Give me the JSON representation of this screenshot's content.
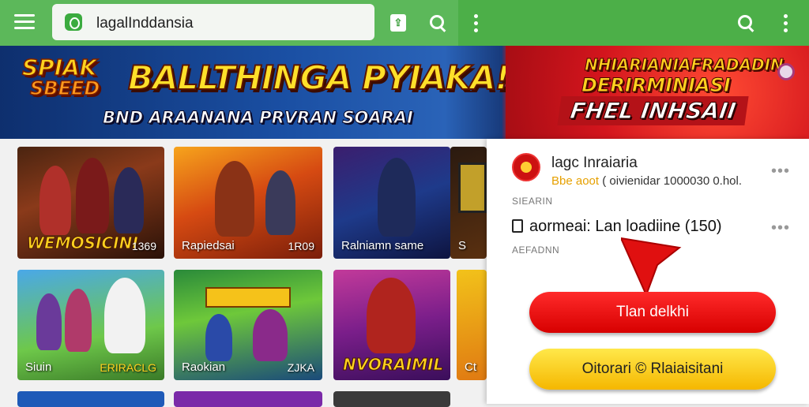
{
  "topbar": {
    "search_query": "lagalInddansia",
    "search_icon": "search-icon",
    "menu_icon": "hamburger-icon",
    "more_icon": "more-vert-icon",
    "share_icon": "share-icon",
    "accent": "#4caf48"
  },
  "banner": {
    "splash_line1": "SPIAK",
    "splash_line2": "SBEED",
    "headline": "BALLTHINGA PYIAKA!",
    "subline": "BND ARAANANA PRVRAN SOARAI",
    "right_line1": "NHIARIANIAFRADADIN",
    "right_line2": "DERIRMINIASI",
    "right_line3": "FHEL INHSAII"
  },
  "games": [
    {
      "big": "WEMOSICINI",
      "badge": "1369"
    },
    {
      "title": "Rapiedsai",
      "badge": "1R09"
    },
    {
      "title": "Ralniamn same",
      "badge": ""
    },
    {
      "title": "S",
      "badge": ""
    },
    {
      "title": "Siuin",
      "badge": "ERIRACLG"
    },
    {
      "title": "Raokian",
      "badge": "ZJKA"
    },
    {
      "big": "NVORAIMIL",
      "badge": ""
    },
    {
      "title": "Ct",
      "badge": ""
    }
  ],
  "panel": {
    "app_name": "lagc Inraiaria",
    "sub_highlight": "Bbe aoot",
    "sub_rest": "( oivienidar 1000030 0.hol.",
    "tag1": "SIEARIN",
    "download_label": "aormeai: Lan loadiine (150)",
    "tag2": "AEFADNN",
    "more": "•••",
    "primary_button": "Tlan delkhi",
    "secondary_button": "Oitorari © Rlaiaisitani"
  }
}
